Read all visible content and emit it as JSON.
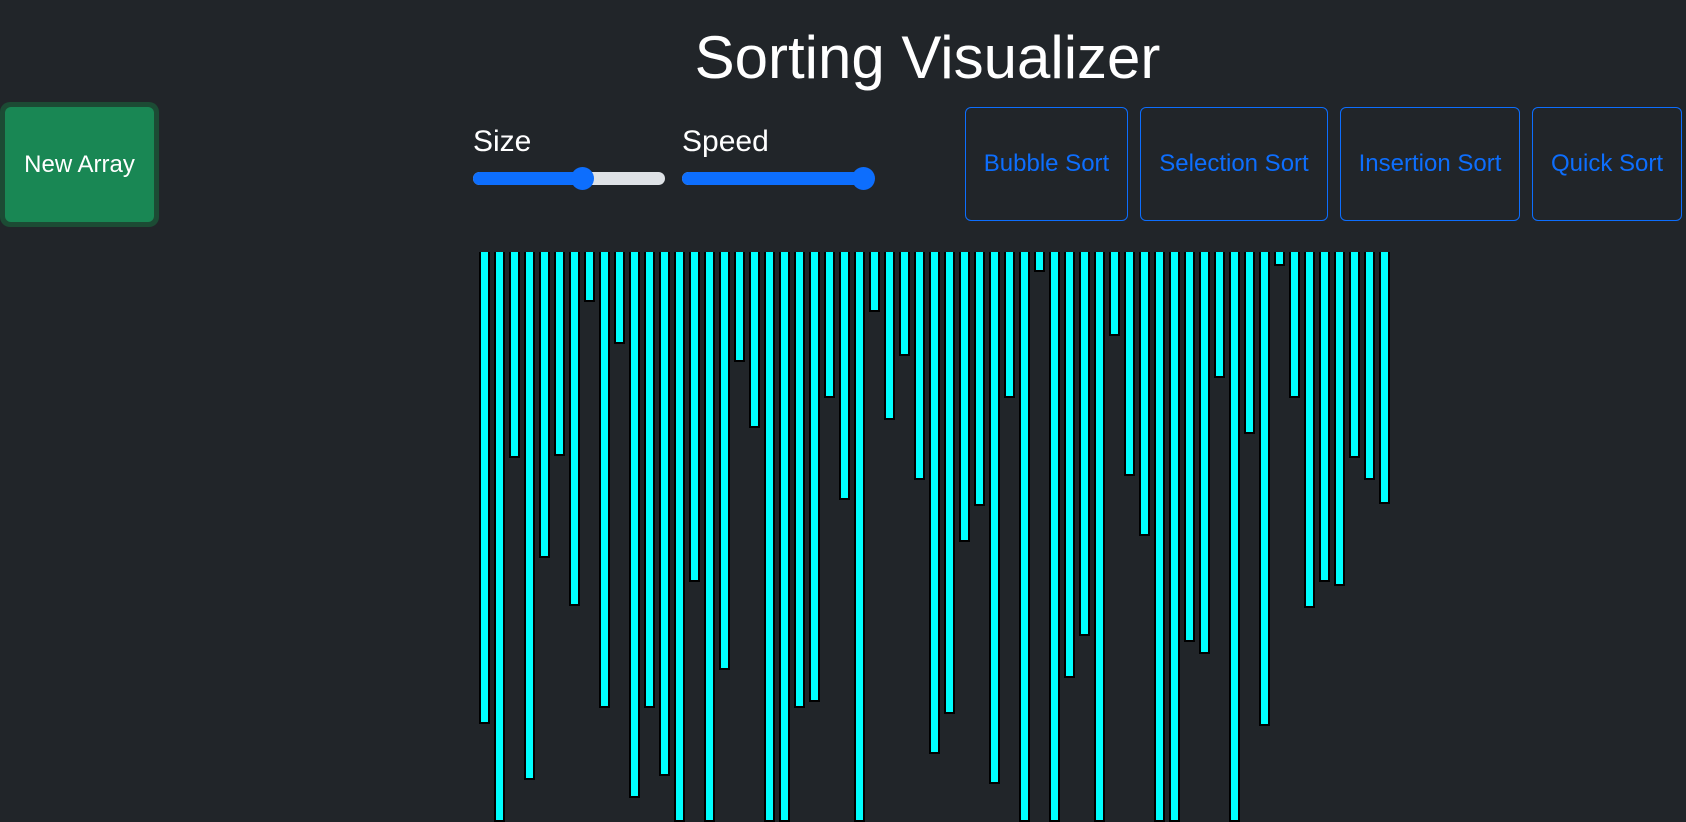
{
  "header": {
    "title": "Sorting Visualizer"
  },
  "controls": {
    "new_array_label": "New Array",
    "size_label": "Size",
    "size_value_fraction": 0.57,
    "speed_label": "Speed",
    "speed_value_fraction": 1.0
  },
  "algorithms": [
    {
      "label": "Bubble Sort"
    },
    {
      "label": "Selection Sort"
    },
    {
      "label": "Insertion Sort"
    },
    {
      "label": "Quick Sort"
    }
  ],
  "colors": {
    "background": "#212529",
    "bar": "#00ffff",
    "bar_border": "#000000",
    "primary": "#0d6efd",
    "success": "#198754"
  },
  "array_values": [
    472,
    570,
    206,
    528,
    306,
    204,
    354,
    50,
    456,
    92,
    546,
    456,
    524,
    570,
    330,
    570,
    418,
    110,
    176,
    570,
    570,
    456,
    450,
    146,
    248,
    570,
    60,
    168,
    104,
    228,
    502,
    462,
    290,
    254,
    532,
    146,
    570,
    20,
    570,
    426,
    384,
    570,
    84,
    224,
    284,
    570,
    570,
    390,
    402,
    126,
    570,
    182,
    474,
    14,
    146,
    356,
    330,
    334,
    206,
    228,
    252
  ]
}
